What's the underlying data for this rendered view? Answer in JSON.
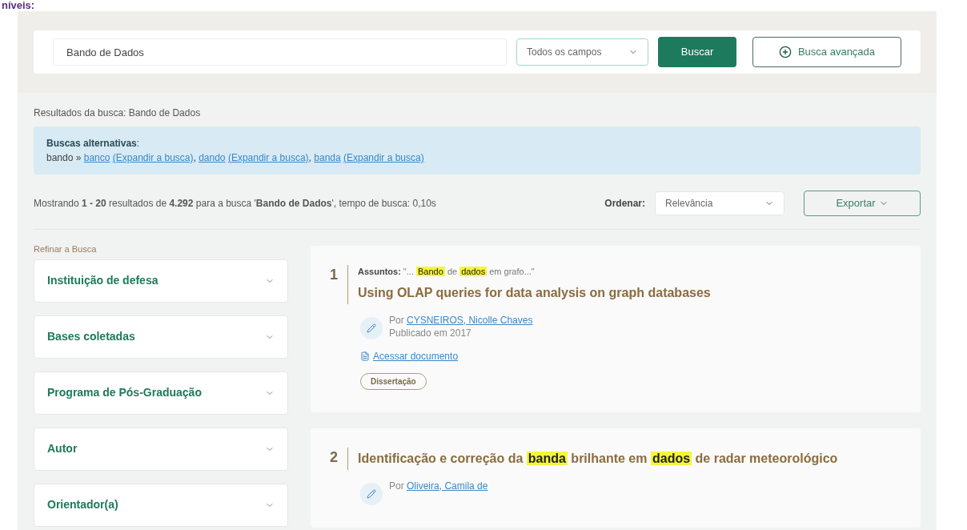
{
  "page_heading": "níveis:",
  "search": {
    "value": "Bando de Dados",
    "field_select": "Todos os campos",
    "submit": "Buscar",
    "advanced": "Busca avançada"
  },
  "results_title": "Resultados da busca: Bando de Dados",
  "alternatives": {
    "heading": "**Buscas alternativas**:",
    "term": "bando »",
    "links": [
      {
        "word": "banco",
        "expand": "(Expandir a busca)",
        "after": ","
      },
      {
        "word": "dando",
        "expand": "(Expandir a busca)",
        "after": ","
      },
      {
        "word": "banda",
        "expand": "(Expandir a busca)"
      }
    ]
  },
  "summary": "Mostrando **1 - 20** resultados de **4.292** para a busca '**Bando de Dados**', tempo de busca: 0,10s",
  "sort": {
    "label": "Ordenar:",
    "value": "Relevância"
  },
  "export": "Exportar",
  "facets": {
    "title": "Refinar a Busca",
    "items": [
      {
        "label": "Instituição de defesa",
        "expanded": false
      },
      {
        "label": "Bases coletadas",
        "expanded": false
      },
      {
        "label": "Programa de Pós-Graduação",
        "expanded": false
      },
      {
        "label": "Autor",
        "expanded": false
      },
      {
        "label": "Orientador(a)",
        "expanded": false
      }
    ]
  },
  "results": [
    {
      "number": "1",
      "snippet_label": "Assuntos:",
      "snippet": [
        {
          "text": "\"...",
          "highlight": false
        },
        {
          "text": "Bando",
          "highlight": true
        },
        {
          "text": "de",
          "highlight": false
        },
        {
          "text": "dados",
          "highlight": true
        },
        {
          "text": "em grafo...\"",
          "highlight": false
        }
      ],
      "title": [
        {
          "text": "Using OLAP queries for data analysis on graph databases",
          "highlight": false
        }
      ],
      "by": "Por",
      "author": "CYSNEIROS, Nicolle Chaves",
      "published": "Publicado em 2017",
      "access": "Acessar documento",
      "type_badge": "Dissertação"
    },
    {
      "number": "2",
      "title": [
        {
          "text": "Identificação e correção da",
          "highlight": false
        },
        {
          "text": "banda",
          "highlight": true
        },
        {
          "text": "brilhante em",
          "highlight": false
        },
        {
          "text": "dados",
          "highlight": true
        },
        {
          "text": "de radar meteorológico",
          "highlight": false
        }
      ],
      "by": "Por",
      "author": "Oliveira, Camila de"
    }
  ]
}
